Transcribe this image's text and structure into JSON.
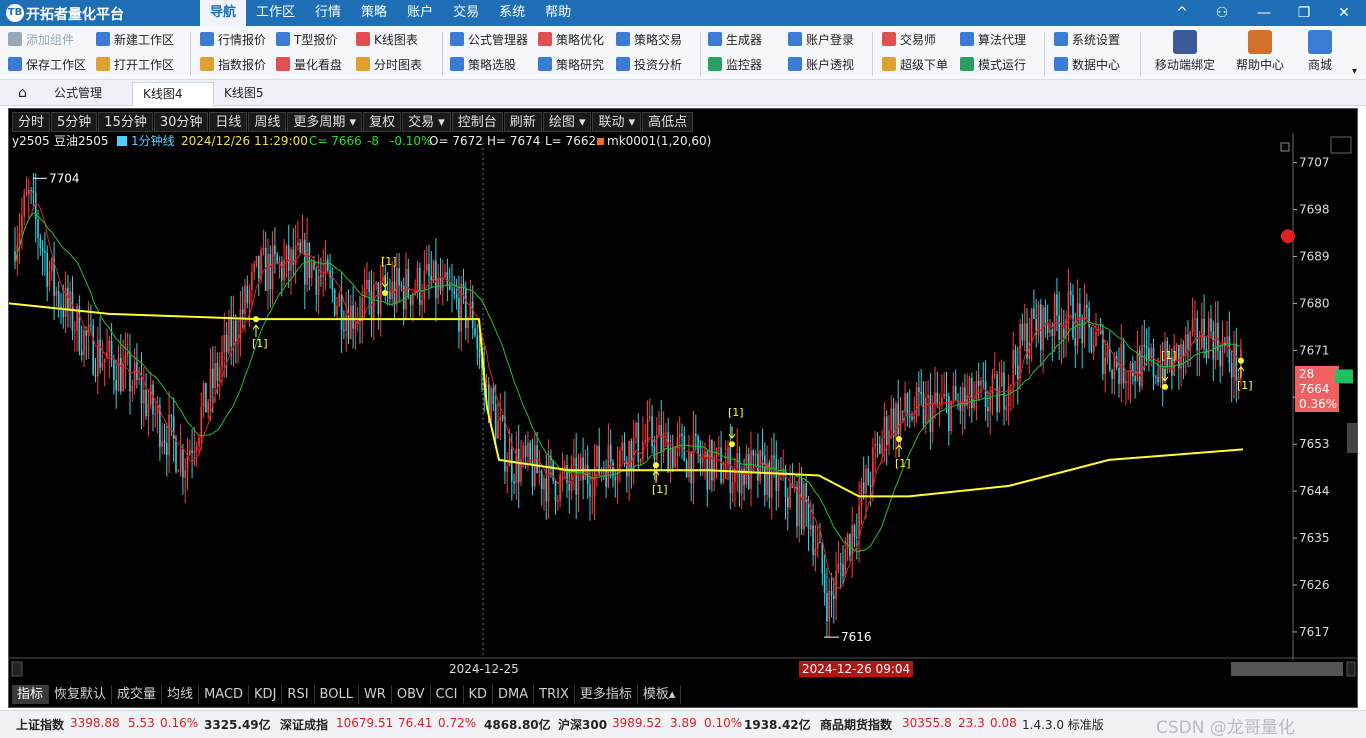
{
  "titlebar": {
    "logo": "TB",
    "title": "开拓者量化平台",
    "menu": [
      "导航",
      "工作区",
      "行情",
      "策略",
      "账户",
      "交易",
      "系统",
      "帮助"
    ],
    "buttons": [
      "^",
      "⚇",
      "—",
      "❐",
      "✕"
    ]
  },
  "toolbar": {
    "items": [
      {
        "label": "添加组件",
        "icon": "add-component-icon",
        "color": "#9aa7b4"
      },
      {
        "label": "保存工作区",
        "icon": "save-workspace-icon",
        "color": "#3a7bd5"
      },
      {
        "label": "新建工作区",
        "icon": "new-workspace-icon",
        "color": "#3a7bd5"
      },
      {
        "label": "打开工作区",
        "icon": "open-workspace-icon",
        "color": "#e0a030"
      },
      {
        "label": "行情报价",
        "icon": "quote-icon",
        "color": "#3a7bd5"
      },
      {
        "label": "指数报价",
        "icon": "index-quote-icon",
        "color": "#e0a030"
      },
      {
        "label": "T型报价",
        "icon": "t-quote-icon",
        "color": "#3a7bd5"
      },
      {
        "label": "量化看盘",
        "icon": "quant-board-icon",
        "color": "#e05050"
      },
      {
        "label": "K线图表",
        "icon": "kline-chart-icon",
        "color": "#e05050"
      },
      {
        "label": "分时图表",
        "icon": "timeshare-chart-icon",
        "color": "#e0a030"
      },
      {
        "label": "公式管理器",
        "icon": "formula-manager-icon",
        "color": "#3a7bd5"
      },
      {
        "label": "策略选股",
        "icon": "strategy-pick-icon",
        "color": "#3a7bd5"
      },
      {
        "label": "策略优化",
        "icon": "strategy-optimize-icon",
        "color": "#e05050"
      },
      {
        "label": "策略研究",
        "icon": "strategy-research-icon",
        "color": "#3a7bd5"
      },
      {
        "label": "策略交易",
        "icon": "strategy-trade-icon",
        "color": "#3a7bd5"
      },
      {
        "label": "投资分析",
        "icon": "invest-analysis-icon",
        "color": "#3a7bd5"
      },
      {
        "label": "生成器",
        "icon": "generator-icon",
        "color": "#3a7bd5"
      },
      {
        "label": "监控器",
        "icon": "monitor-icon",
        "color": "#2aa060"
      },
      {
        "label": "账户登录",
        "icon": "account-login-icon",
        "color": "#3a7bd5"
      },
      {
        "label": "账户透视",
        "icon": "account-view-icon",
        "color": "#3a7bd5"
      },
      {
        "label": "交易师",
        "icon": "trader-icon",
        "color": "#e05050"
      },
      {
        "label": "超级下单",
        "icon": "super-order-icon",
        "color": "#e0a030"
      },
      {
        "label": "算法代理",
        "icon": "algo-agent-icon",
        "color": "#3a7bd5"
      },
      {
        "label": "模式运行",
        "icon": "mode-run-icon",
        "color": "#2aa060"
      },
      {
        "label": "系统设置",
        "icon": "system-settings-icon",
        "color": "#3a7bd5"
      },
      {
        "label": "数据中心",
        "icon": "data-center-icon",
        "color": "#3a7bd5"
      }
    ],
    "big": [
      {
        "label": "移动端绑定",
        "icon": "mobile-bind-icon",
        "color": "#3a5a9a"
      },
      {
        "label": "帮助中心",
        "icon": "help-center-icon",
        "color": "#d0702a"
      },
      {
        "label": "商城",
        "icon": "mall-icon",
        "color": "#3a7bd5"
      }
    ]
  },
  "tabs": {
    "home_icon": "home-icon",
    "items": [
      "公式管理",
      "K线图4",
      "K线图5"
    ],
    "close": "×"
  },
  "chart_toolbar": [
    "分时",
    "5分钟",
    "15分钟",
    "30分钟",
    "日线",
    "周线",
    "更多周期 ▾",
    "复权",
    "交易 ▾",
    "控制台",
    "刷新",
    "绘图 ▾",
    "联动 ▾",
    "高低点"
  ],
  "chart_info": {
    "symbol": "y2505",
    "name": "豆油2505",
    "period": "1分钟线",
    "datetime": "2024/12/26 11:29:00",
    "close": "C= 7666",
    "change": "-8",
    "pct": "-0.10%",
    "open": "O= 7672",
    "high": "H= 7674",
    "low": "L= 7662",
    "indicator": "mk0001(1,20,60)"
  },
  "chart_labels": {
    "high_mark": "7704",
    "low_mark": "7616",
    "date1": "2024-12-25",
    "date2": "2024-12-26 09:04",
    "price_box": [
      "28",
      "7664",
      "0.36%"
    ],
    "signal": "[1]"
  },
  "colors": {
    "up": "#ff3b3b",
    "down": "#35d0e0",
    "ma_fast": "#e02020",
    "ma_slow": "#20c020",
    "avg": "#ffff30",
    "bg": "#000000",
    "price_box": "#f06060"
  },
  "chart_data": {
    "type": "candlestick",
    "period": "1分钟线",
    "ylim": [
      7612,
      7710
    ],
    "y_ticks": [
      7707,
      7698,
      7689,
      7680,
      7671,
      7662,
      7653,
      7644,
      7635,
      7626,
      7617
    ],
    "x_labels": [
      "2024-12-25",
      "2024-12-26 09:04"
    ],
    "last": {
      "open": 7672,
      "high": 7674,
      "low": 7662,
      "close": 7666,
      "change": -8,
      "pct": "-0.10%"
    },
    "marks": {
      "high": 7704,
      "low": 7616
    }
  },
  "bottom_tabs": [
    "指标",
    "恢复默认",
    "成交量",
    "均线",
    "MACD",
    "KDJ",
    "RSI",
    "BOLL",
    "WR",
    "OBV",
    "CCI",
    "KD",
    "DMA",
    "TRIX",
    "更多指标",
    "模板▴"
  ],
  "status": [
    {
      "name": "上证指数",
      "v1": "3398.88",
      "v2": "5.53",
      "v3": "0.16%",
      "v4": "3325.49亿"
    },
    {
      "name": "深证成指",
      "v1": "10679.51",
      "v2": "76.41",
      "v3": "0.72%",
      "v4": "4868.80亿"
    },
    {
      "name": "沪深300",
      "v1": "3989.52",
      "v2": "3.89",
      "v3": "0.10%",
      "v4": "1938.42亿"
    },
    {
      "name": "商品期货指数",
      "v1": "30355.8",
      "v2": "23.3",
      "v3": "0.08",
      "v4": ""
    }
  ],
  "version": "1.4.3.0 标准版",
  "watermark": "CSDN @龙哥量化"
}
